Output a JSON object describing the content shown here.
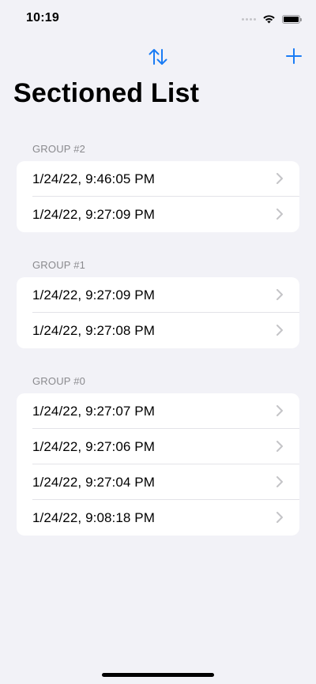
{
  "status_bar": {
    "time": "10:19"
  },
  "nav": {
    "sort_icon": "sort-arrows-icon",
    "add_icon": "plus-icon",
    "accent_color": "#1a7cf5"
  },
  "title": "Sectioned List",
  "sections": [
    {
      "header": "GROUP #2",
      "rows": [
        "1/24/22, 9:46:05 PM",
        "1/24/22, 9:27:09 PM"
      ]
    },
    {
      "header": "GROUP #1",
      "rows": [
        "1/24/22, 9:27:09 PM",
        "1/24/22, 9:27:08 PM"
      ]
    },
    {
      "header": "GROUP #0",
      "rows": [
        "1/24/22, 9:27:07 PM",
        "1/24/22, 9:27:06 PM",
        "1/24/22, 9:27:04 PM",
        "1/24/22, 9:08:18 PM"
      ]
    }
  ]
}
